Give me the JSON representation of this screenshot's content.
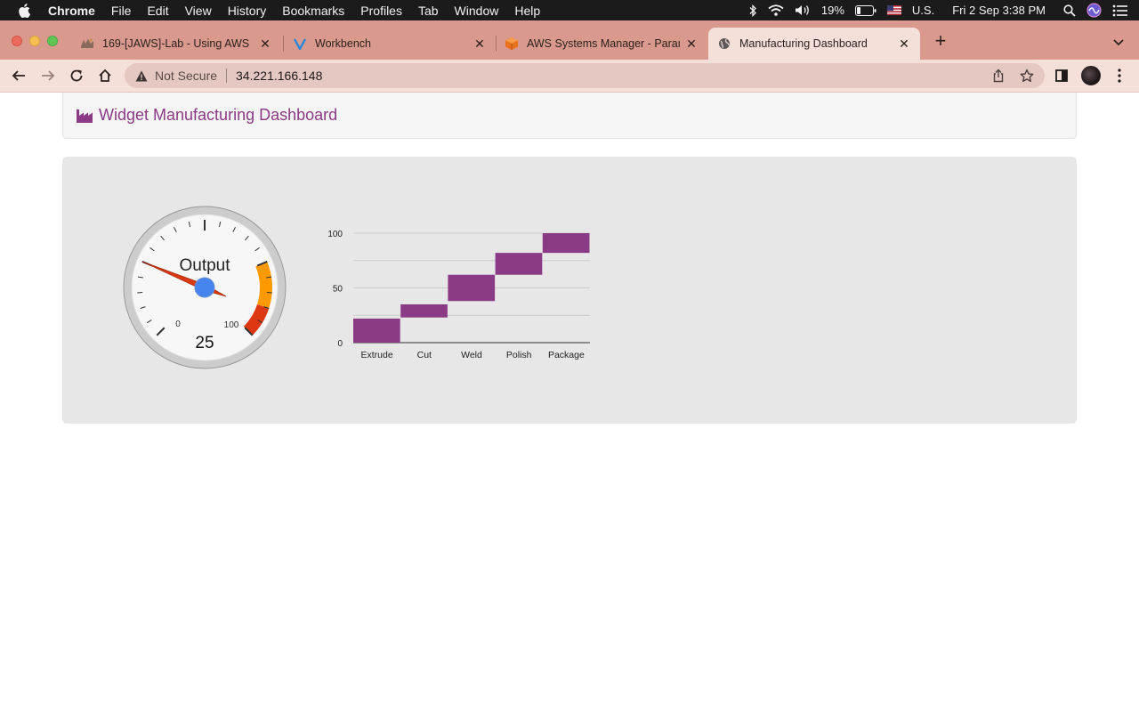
{
  "menubar": {
    "app_name": "Chrome",
    "menus": [
      "File",
      "Edit",
      "View",
      "History",
      "Bookmarks",
      "Profiles",
      "Tab",
      "Window",
      "Help"
    ],
    "battery": "19%",
    "input_source": "U.S.",
    "datetime": "Fri 2 Sep  3:38 PM"
  },
  "tabs": [
    {
      "title": "169-[JAWS]-Lab - Using AWS",
      "active": false
    },
    {
      "title": "Workbench",
      "active": false
    },
    {
      "title": "AWS Systems Manager - Paran",
      "active": false
    },
    {
      "title": "Manufacturing Dashboard",
      "active": true
    }
  ],
  "toolbar": {
    "security_label": "Not Secure",
    "url": "34.221.166.148"
  },
  "page": {
    "brand_title": "Widget Manufacturing Dashboard",
    "accent_color": "#8b3a86"
  },
  "gauge": {
    "label": "Output",
    "value": 25,
    "min": 0,
    "max": 100,
    "min_label": "0",
    "max_label": "100",
    "value_label": "25",
    "needle_color": "#dc3912",
    "yellow_band_color": "#ff9900",
    "red_band_color": "#dc3912"
  },
  "chart_data": {
    "type": "bar",
    "subtype": "waterfall",
    "categories": [
      "Extrude",
      "Cut",
      "Weld",
      "Polish",
      "Package"
    ],
    "ranges": [
      [
        0,
        22
      ],
      [
        23,
        35
      ],
      [
        38,
        62
      ],
      [
        62,
        82
      ],
      [
        82,
        100
      ]
    ],
    "ylim": [
      0,
      100
    ],
    "yticks": [
      "0",
      "50",
      "100"
    ],
    "bar_color": "#8b3a86",
    "grid": true,
    "legend": "none"
  }
}
